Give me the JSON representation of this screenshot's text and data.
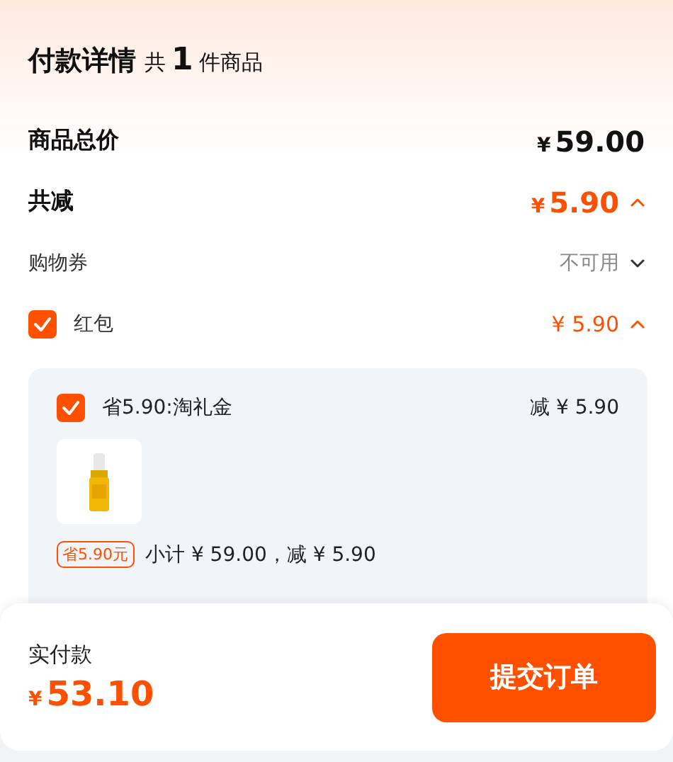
{
  "header": {
    "title": "付款详情",
    "count_prefix": "共",
    "count": "1",
    "count_suffix": "件商品"
  },
  "summary": [
    {
      "kind": "total",
      "label": "商品总价",
      "currency": "¥",
      "amount": "59.00"
    },
    {
      "kind": "discount",
      "label": "共减",
      "currency": "¥",
      "amount": "5.90",
      "expanded": true
    }
  ],
  "options": [
    {
      "kind": "plain",
      "label": "购物券",
      "value": "不可用",
      "expanded": false
    },
    {
      "kind": "check",
      "label": "红包",
      "checked": true,
      "currency": "¥",
      "amount": "5.90",
      "expanded": true
    }
  ],
  "panel": {
    "items": [
      {
        "label": "省5.90:淘礼金",
        "checked": true,
        "amount": "减 ¥ 5.90",
        "tag": "省5.90元",
        "subtotal": "小计 ¥ 59.00，减 ¥ 5.90"
      }
    ]
  },
  "footer": {
    "label": "实付款",
    "currency": "¥",
    "amount": "53.10",
    "button": "提交订单"
  }
}
